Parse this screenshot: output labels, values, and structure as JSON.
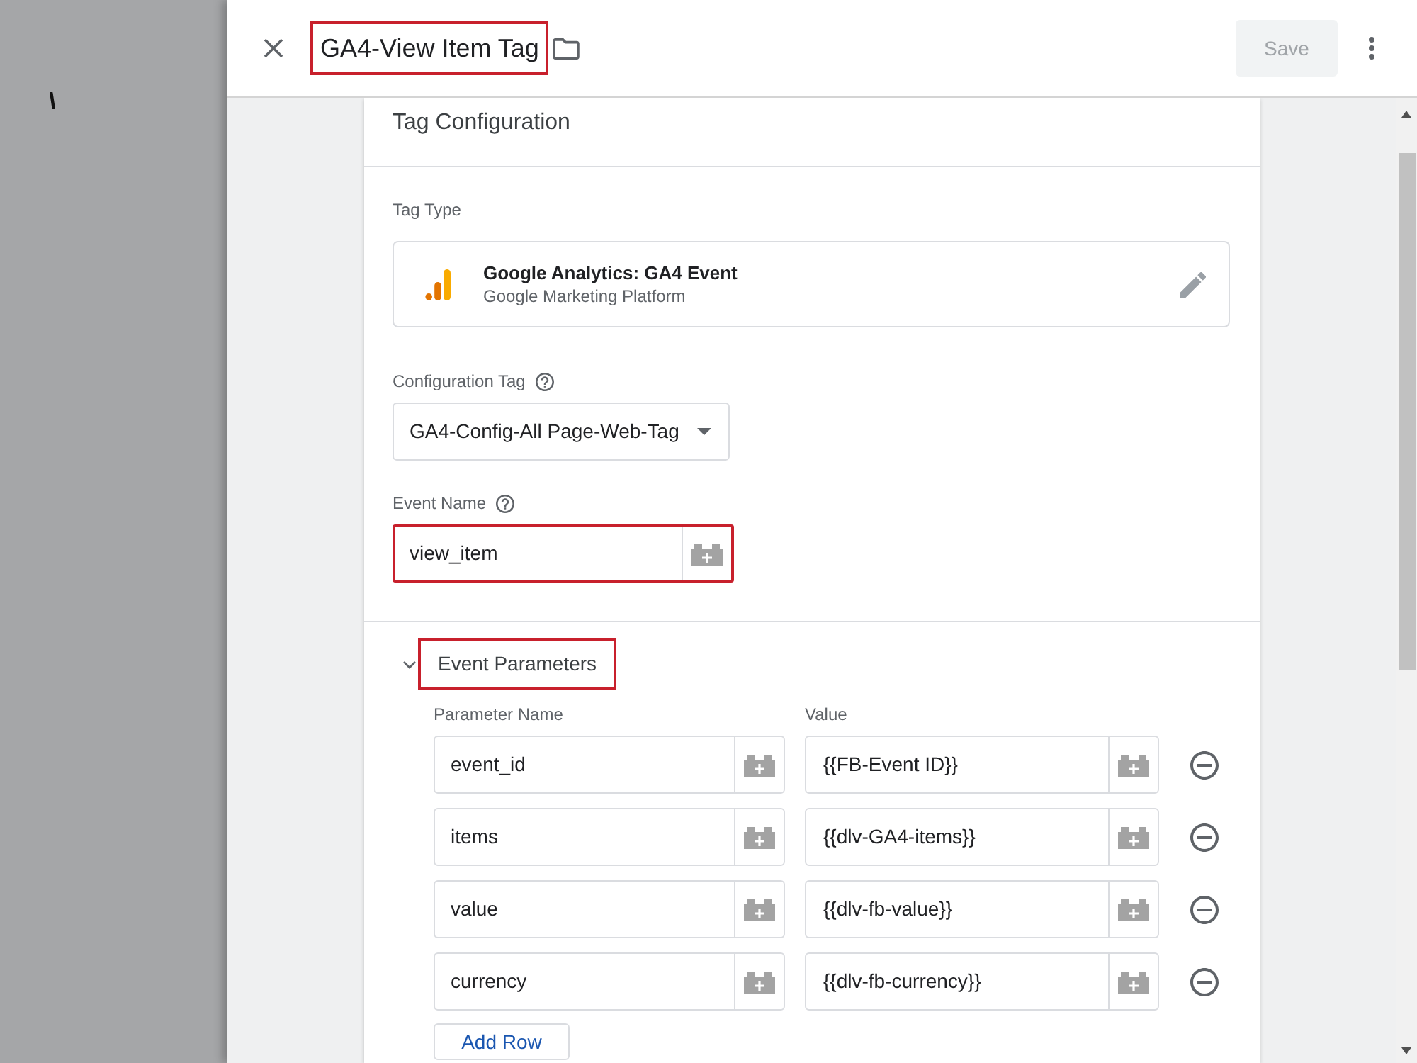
{
  "header": {
    "title": "GA4-View Item Tag",
    "highlighted": true,
    "save_button": {
      "label": "Save",
      "disabled": true
    }
  },
  "tag_configuration": {
    "heading": "Tag Configuration",
    "tag_type": {
      "label": "Tag Type",
      "name": "Google Analytics: GA4 Event",
      "vendor": "Google Marketing Platform"
    },
    "configuration_tag": {
      "label": "Configuration Tag",
      "value": "GA4-Config-All Page-Web-Tag"
    },
    "event_name": {
      "label": "Event Name",
      "value": "view_item",
      "highlighted": true
    },
    "event_parameters": {
      "label": "Event Parameters",
      "expanded": true,
      "highlighted": true,
      "columns": [
        "Parameter Name",
        "Value"
      ],
      "rows": [
        {
          "name": "event_id",
          "value": "{{FB-Event ID}}"
        },
        {
          "name": "items",
          "value": "{{dlv-GA4-items}}"
        },
        {
          "name": "value",
          "value": "{{dlv-fb-value}}"
        },
        {
          "name": "currency",
          "value": "{{dlv-fb-currency}}"
        }
      ],
      "add_button": "Add Row"
    }
  }
}
